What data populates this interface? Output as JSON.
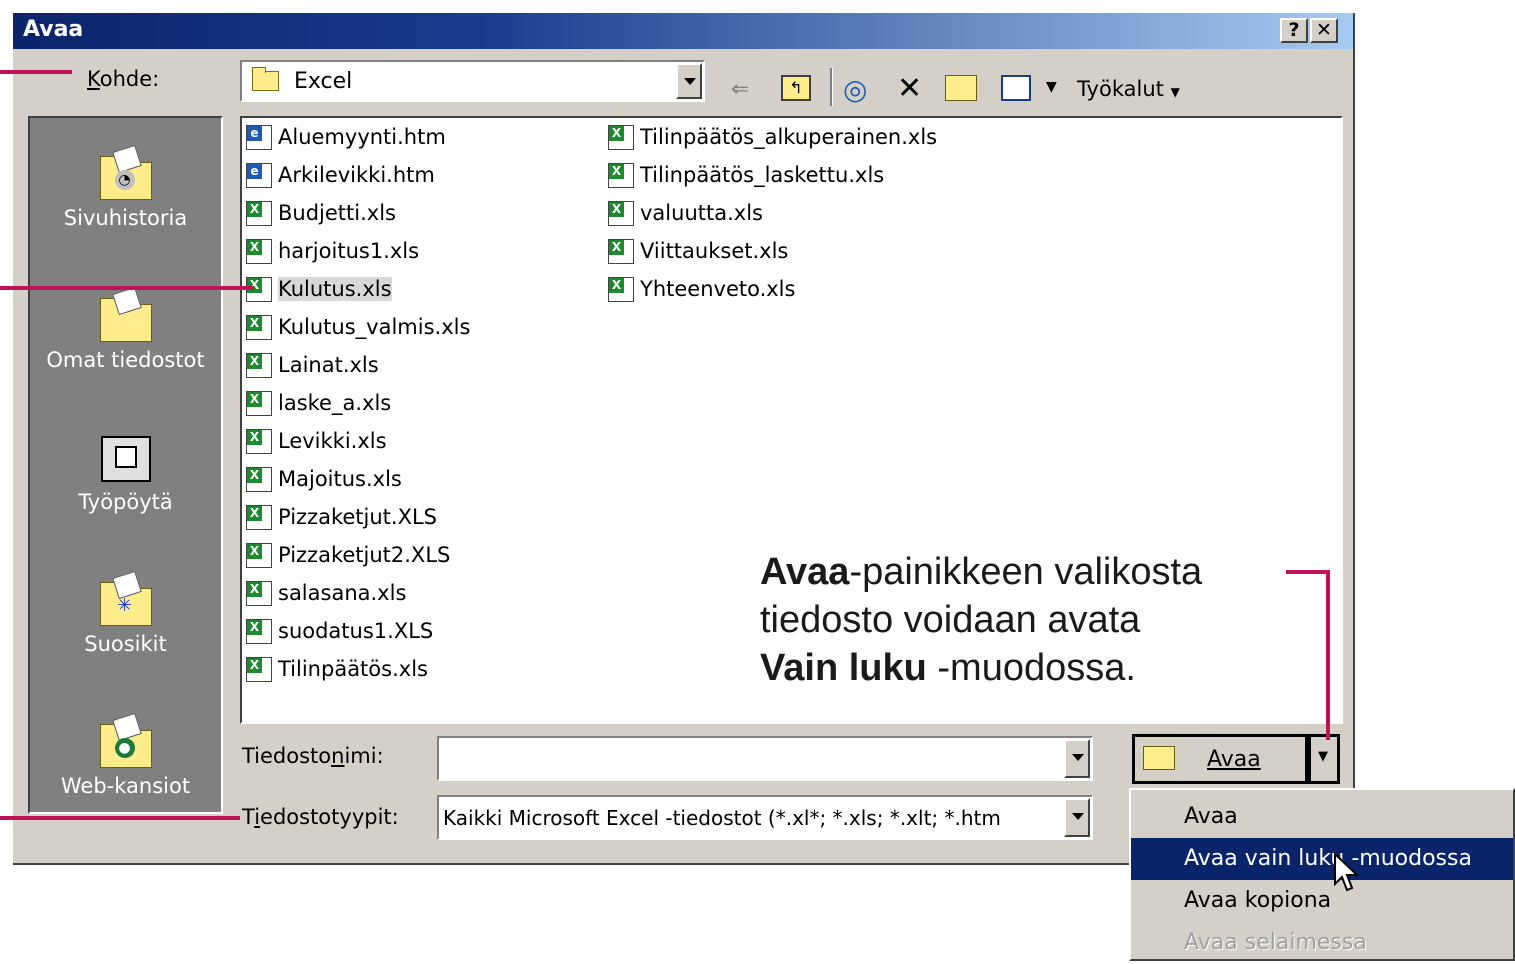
{
  "dialog": {
    "title": "Avaa",
    "help_label": "?",
    "close_label": "✕"
  },
  "toolbar": {
    "look_in_label": "Kohde:",
    "look_in_value": "Excel",
    "tools_label": "Työkalut"
  },
  "places": [
    {
      "label": "Sivuhistoria",
      "icon": "history-icon"
    },
    {
      "label": "Omat tiedostot",
      "icon": "my-documents-icon"
    },
    {
      "label": "Työpöytä",
      "icon": "desktop-icon"
    },
    {
      "label": "Suosikit",
      "icon": "favorites-icon"
    },
    {
      "label": "Web-kansiot",
      "icon": "web-folders-icon"
    }
  ],
  "files": [
    {
      "name": "Aluemyynti.htm",
      "type": "web"
    },
    {
      "name": "Arkilevikki.htm",
      "type": "web"
    },
    {
      "name": "Budjetti.xls",
      "type": "xls"
    },
    {
      "name": "harjoitus1.xls",
      "type": "xls"
    },
    {
      "name": "Kulutus.xls",
      "type": "xls",
      "selected": true
    },
    {
      "name": "Kulutus_valmis.xls",
      "type": "xls"
    },
    {
      "name": "Lainat.xls",
      "type": "xls"
    },
    {
      "name": "laske_a.xls",
      "type": "xls"
    },
    {
      "name": "Levikki.xls",
      "type": "xls"
    },
    {
      "name": "Majoitus.xls",
      "type": "xls"
    },
    {
      "name": "Pizzaketjut.XLS",
      "type": "xls"
    },
    {
      "name": "Pizzaketjut2.XLS",
      "type": "xls"
    },
    {
      "name": "salasana.xls",
      "type": "xls"
    },
    {
      "name": "suodatus1.XLS",
      "type": "xls"
    },
    {
      "name": "Tilinpäätös.xls",
      "type": "xls"
    },
    {
      "name": "Tilinpäätös_alkuperainen.xls",
      "type": "xls"
    },
    {
      "name": "Tilinpäätös_laskettu.xls",
      "type": "xls"
    },
    {
      "name": "valuutta.xls",
      "type": "xls"
    },
    {
      "name": "Viittaukset.xls",
      "type": "xls"
    },
    {
      "name": "Yhteenveto.xls",
      "type": "xls"
    }
  ],
  "filename": {
    "label": "Tiedostonimi:",
    "value": ""
  },
  "filetype": {
    "label": "Tiedostotyypit:",
    "value": "Kaikki Microsoft Excel -tiedostot (*.xl*; *.xls; *.xlt; *.htm"
  },
  "open_button": {
    "label": "Avaa"
  },
  "open_menu": [
    {
      "label": "Avaa",
      "state": "normal"
    },
    {
      "label": "Avaa vain luku -muodossa",
      "state": "highlighted"
    },
    {
      "label": "Avaa kopiona",
      "state": "normal"
    },
    {
      "label": "Avaa selaimessa",
      "state": "disabled"
    }
  ],
  "callout": {
    "bold1": "Avaa",
    "text1": "-painikkeen valikosta",
    "text2": "tiedosto voidaan avata",
    "bold2": "Vain luku",
    "text3": " -muodossa."
  },
  "colors": {
    "title_bar": "#0a246a",
    "callout_line": "#c0125a",
    "highlight": "#0a246a"
  }
}
